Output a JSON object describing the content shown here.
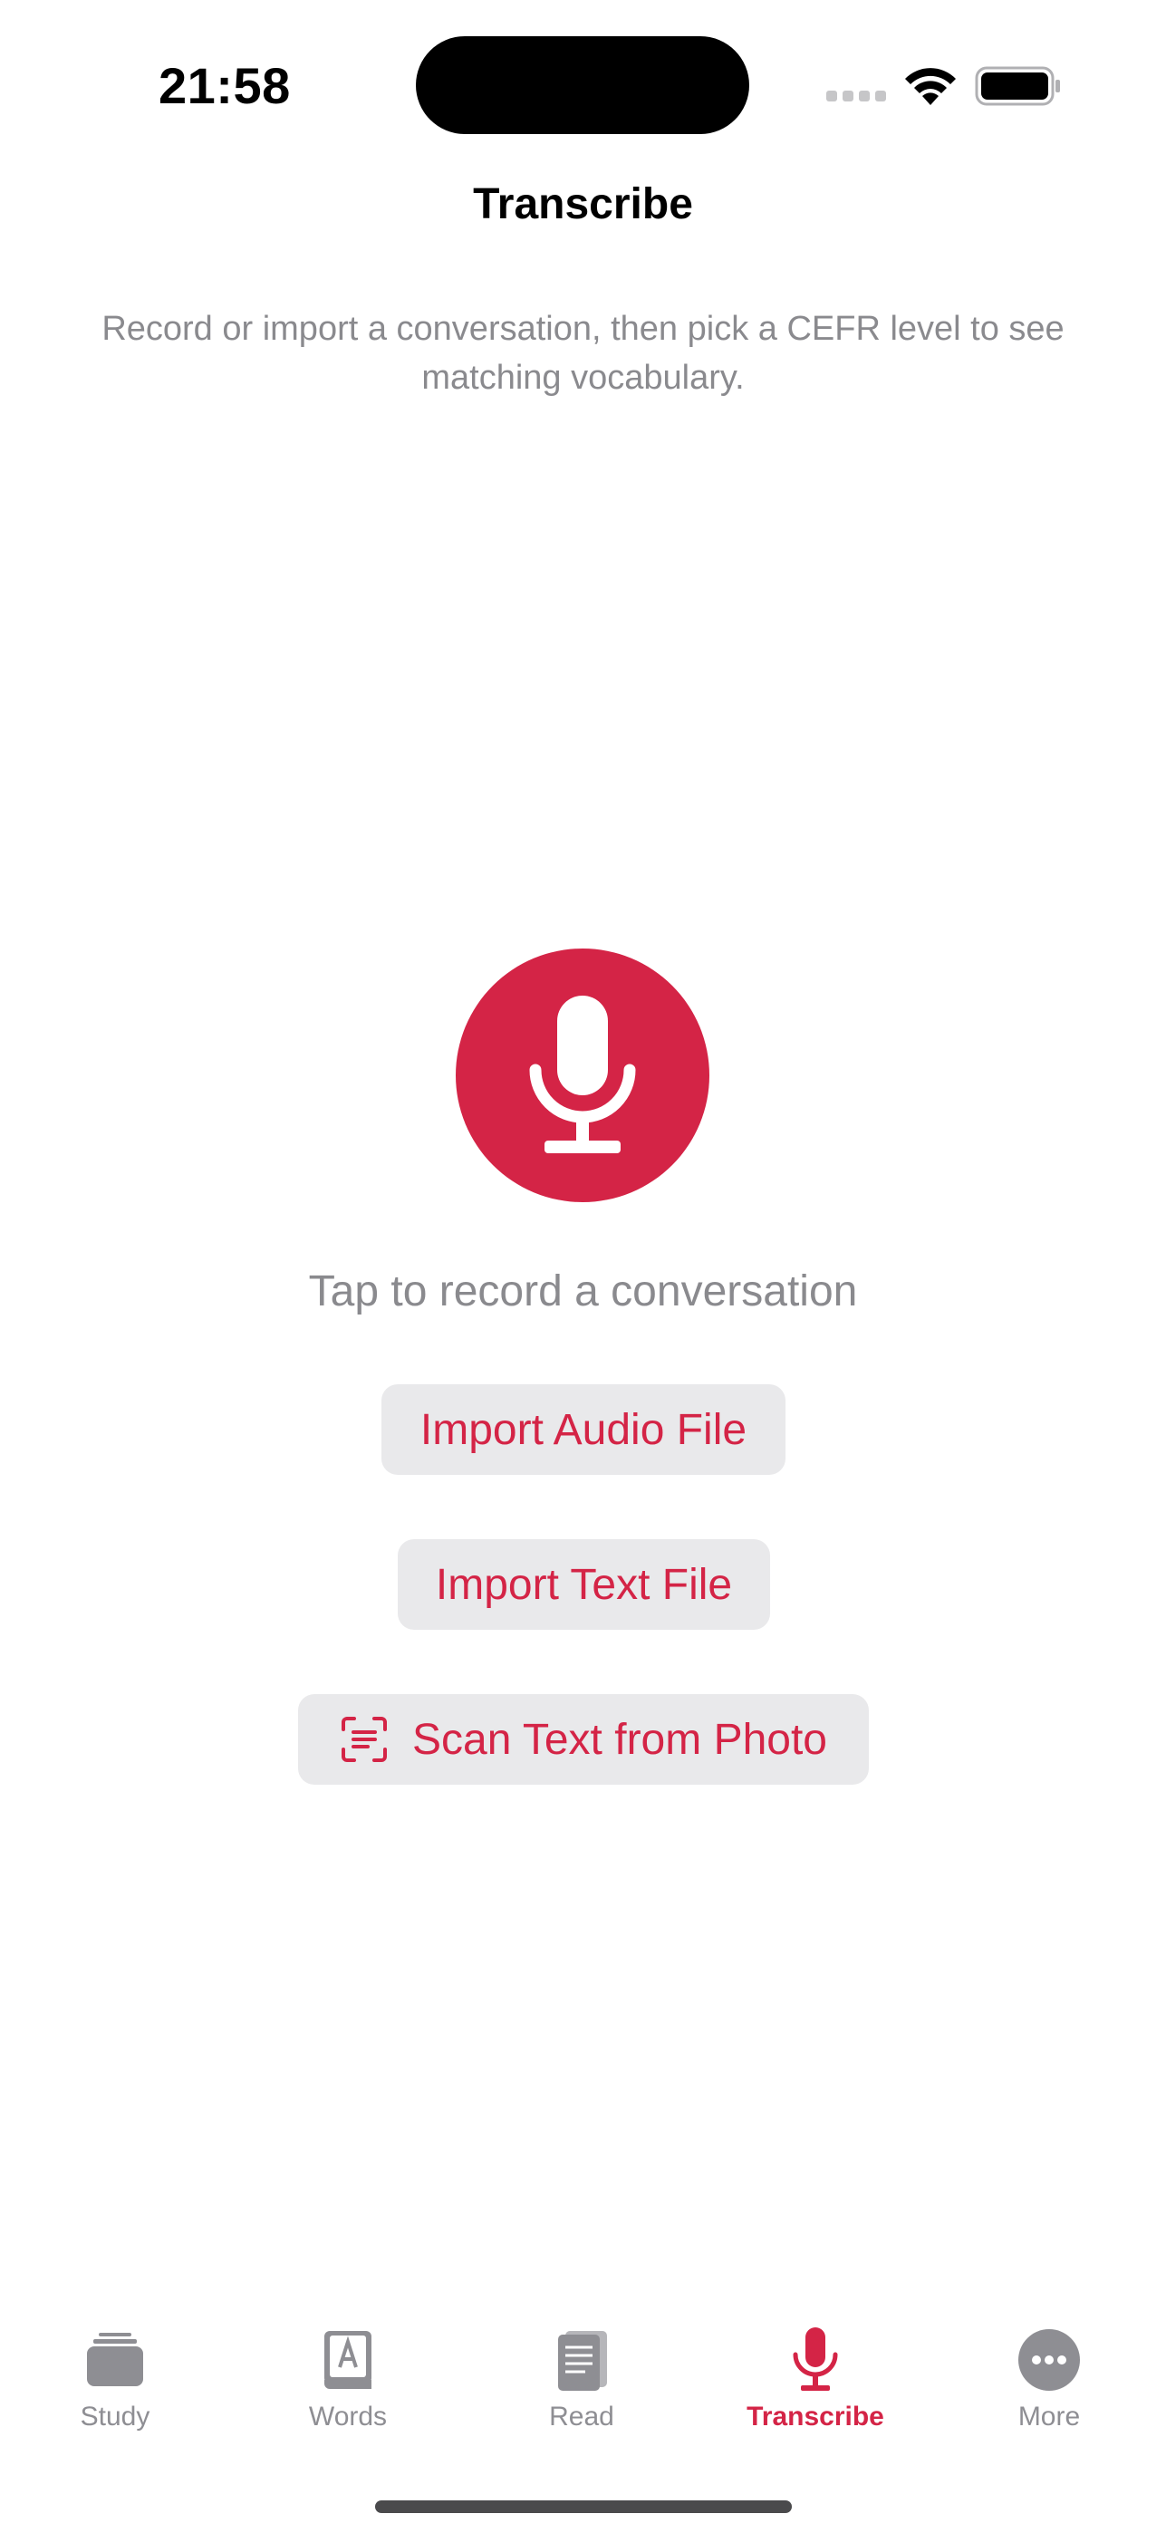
{
  "status_bar": {
    "time": "21:58"
  },
  "nav": {
    "title": "Transcribe"
  },
  "intro": {
    "text": "Record or import a conversation, then pick a CEFR level to see matching vocabulary."
  },
  "record": {
    "icon": "mic-icon",
    "hint": "Tap to record a conversation"
  },
  "actions": {
    "import_audio": "Import Audio File",
    "import_text": "Import Text File",
    "scan_text": "Scan Text from Photo"
  },
  "tabs": [
    {
      "label": "Study",
      "icon": "cards-stack-icon",
      "active": false
    },
    {
      "label": "Words",
      "icon": "dictionary-icon",
      "active": false
    },
    {
      "label": "Read",
      "icon": "book-icon",
      "active": false
    },
    {
      "label": "Transcribe",
      "icon": "mic-icon",
      "active": true
    },
    {
      "label": "More",
      "icon": "ellipsis-circle-icon",
      "active": false
    }
  ],
  "colors": {
    "accent": "#D42446",
    "secondary_text": "#8A8A8E",
    "tab_inactive": "#8E8E93",
    "pill_bg": "#E9E9EB"
  }
}
